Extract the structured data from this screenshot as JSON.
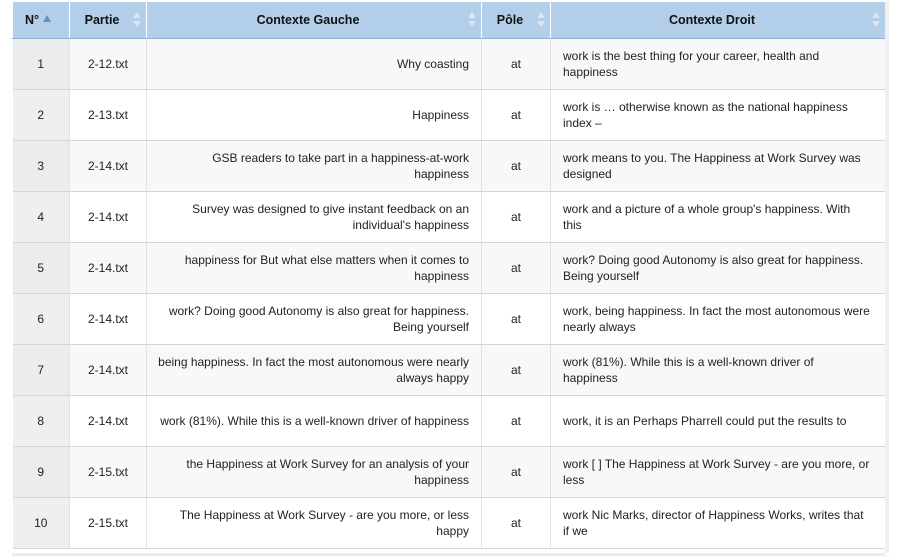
{
  "columns": {
    "num": "N°",
    "partie": "Partie",
    "contexte_gauche": "Contexte Gauche",
    "pole": "Pôle",
    "contexte_droit": "Contexte Droit"
  },
  "rows": [
    {
      "num": "1",
      "partie": "2-12.txt",
      "gauche": "Why coasting",
      "pole": "at",
      "droit": "work is the best thing for your career, health and happiness"
    },
    {
      "num": "2",
      "partie": "2-13.txt",
      "gauche": "Happiness",
      "pole": "at",
      "droit": "work is … otherwise known as the national happiness index –"
    },
    {
      "num": "3",
      "partie": "2-14.txt",
      "gauche": "GSB readers to take part in a happiness-at-work happiness",
      "pole": "at",
      "droit": "work means to you. The Happiness at Work Survey was designed"
    },
    {
      "num": "4",
      "partie": "2-14.txt",
      "gauche": "Survey was designed to give instant feedback on an individual's happiness",
      "pole": "at",
      "droit": "work and a picture of a whole group's happiness. With this"
    },
    {
      "num": "5",
      "partie": "2-14.txt",
      "gauche": "happiness for But what else matters when it comes to happiness",
      "pole": "at",
      "droit": "work? Doing good Autonomy is also great for happiness. Being yourself"
    },
    {
      "num": "6",
      "partie": "2-14.txt",
      "gauche": "work? Doing good Autonomy is also great for happiness. Being yourself",
      "pole": "at",
      "droit": "work, being happiness. In fact the most autonomous were nearly always"
    },
    {
      "num": "7",
      "partie": "2-14.txt",
      "gauche": "being happiness. In fact the most autonomous were nearly always happy",
      "pole": "at",
      "droit": "work (81%). While this is a well-known driver of happiness"
    },
    {
      "num": "8",
      "partie": "2-14.txt",
      "gauche": "work (81%). While this is a well-known driver of happiness",
      "pole": "at",
      "droit": "work, it is an Perhaps Pharrell could put the results to"
    },
    {
      "num": "9",
      "partie": "2-15.txt",
      "gauche": "the Happiness at Work Survey for an analysis of your happiness",
      "pole": "at",
      "droit": "work [ ] The Happiness at Work Survey - are you more, or less"
    },
    {
      "num": "10",
      "partie": "2-15.txt",
      "gauche": "The Happiness at Work Survey - are you more, or less happy",
      "pole": "at",
      "droit": "work Nic Marks, director of Happiness Works, writes that if we"
    }
  ],
  "sort": {
    "column": "num",
    "direction": "ascending"
  },
  "colors": {
    "header_bg": "#b3cee8",
    "sort_active": "#6a8ec4",
    "row_alt": "#f8f8f8"
  }
}
